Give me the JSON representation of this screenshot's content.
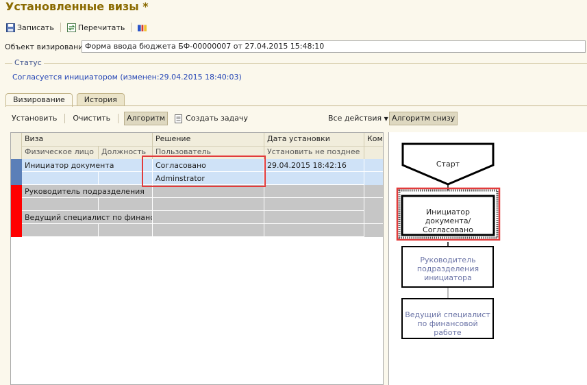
{
  "window": {
    "title": "Установленные визы *"
  },
  "toolbar": {
    "save_label": "Записать",
    "reread_label": "Перечитать"
  },
  "object": {
    "label": "Объект визирования:",
    "value": "Форма ввода бюджета БФ-00000007 от 27.04.2015 15:48:10"
  },
  "status": {
    "group_title": "Статус",
    "text": "Согласуется инициатором (изменен:29.04.2015 18:40:03)"
  },
  "tabs": [
    {
      "label": "Визирование"
    },
    {
      "label": "История"
    }
  ],
  "commands": {
    "set": "Установить",
    "clear": "Очистить",
    "algorithm": "Алгоритм",
    "create_task": "Создать задачу",
    "all_actions": "Все действия",
    "algorithm_below": "Алгоритм снизу"
  },
  "table": {
    "headers_top": [
      "Виза",
      "Решение",
      "Дата установки",
      "Комм"
    ],
    "headers_bottom": [
      "Физическое лицо",
      "Должность",
      "Пользователь",
      "Установить не позднее"
    ],
    "rows": [
      {
        "visa": "Инициатор документа",
        "decision": "Согласовано",
        "user": "Adminstrator",
        "date": "29.04.2015 18:42:16"
      },
      {
        "visa": "Руководитель подразделения",
        "decision": "",
        "user": "",
        "date": ""
      },
      {
        "visa": "Ведущий специалист по финансо...",
        "decision": "",
        "user": "",
        "date": ""
      }
    ]
  },
  "diagram": {
    "start": "Старт",
    "node1": "Инициатор документа/Согласовано",
    "node2": "Руководитель подразделения инициатора",
    "node3": "Ведущий специалист по финансовой работе"
  },
  "colors": {
    "title": "#8a6a00",
    "status_text": "#2445b5",
    "selected_row": "#cfe2f7",
    "selected_marker": "#5b7fb8",
    "gray_row": "#c6c6c6",
    "red_marker": "#ff0000",
    "highlight": "#e23b3b",
    "inactive_node_text": "#6a73a6"
  }
}
